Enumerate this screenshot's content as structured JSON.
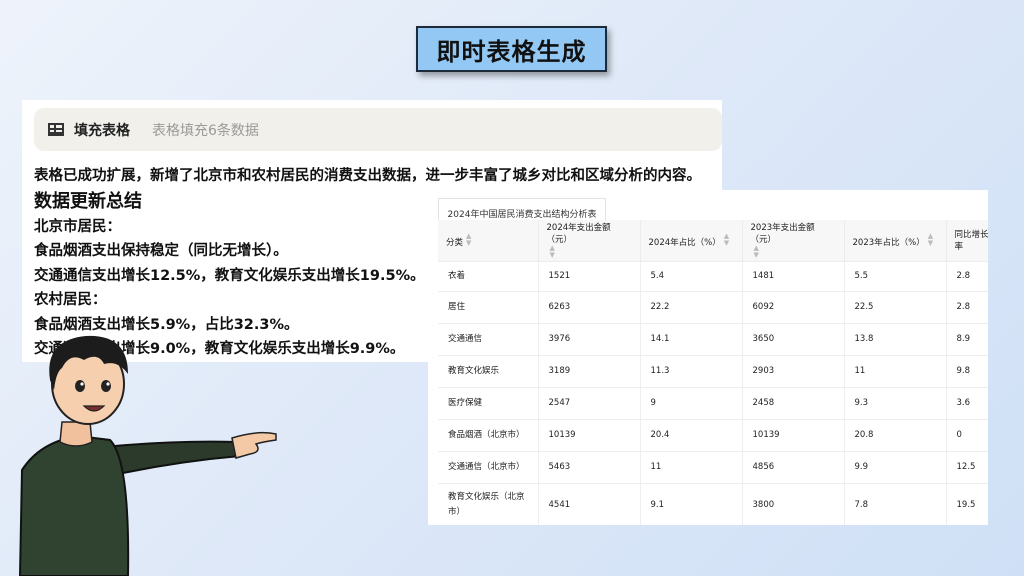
{
  "header": {
    "title": "即时表格生成"
  },
  "tool_call": {
    "icon": "table-icon",
    "name": "填充表格",
    "description": "表格填充6条数据"
  },
  "message": {
    "intro": "表格已成功扩展，新增了北京市和农村居民的消费支出数据，进一步丰富了城乡对比和区域分析的内容。",
    "summary_heading": "数据更新总结",
    "sections": [
      {
        "heading": "北京市居民：",
        "lines": [
          "食品烟酒支出保持稳定（同比无增长）。",
          "交通通信支出增长12.5%，教育文化娱乐支出增长19.5%。"
        ]
      },
      {
        "heading": "农村居民：",
        "lines": [
          "食品烟酒支出增长5.9%，占比32.3%。",
          "交通通信支出增长9.0%，教育文化娱乐支出增长9.9%。"
        ]
      }
    ]
  },
  "table": {
    "tab_label": "2024年中国居民消费支出结构分析表",
    "columns": [
      "分类",
      "2024年支出金额（元）",
      "2024年占比（%）",
      "2023年支出金额（元）",
      "2023年占比（%）",
      "同比增长率"
    ],
    "rows": [
      [
        "衣着",
        "1521",
        "5.4",
        "1481",
        "5.5",
        "2.8"
      ],
      [
        "居住",
        "6263",
        "22.2",
        "6092",
        "22.5",
        "2.8"
      ],
      [
        "交通通信",
        "3976",
        "14.1",
        "3650",
        "13.8",
        "8.9"
      ],
      [
        "教育文化娱乐",
        "3189",
        "11.3",
        "2903",
        "11",
        "9.8"
      ],
      [
        "医疗保健",
        "2547",
        "9",
        "2458",
        "9.3",
        "3.6"
      ],
      [
        "食品烟酒（北京市）",
        "10139",
        "20.4",
        "10139",
        "20.8",
        "0"
      ],
      [
        "交通通信（北京市）",
        "5463",
        "11",
        "4856",
        "9.9",
        "12.5"
      ],
      [
        "教育文化娱乐（北京市）",
        "4541",
        "9.1",
        "3800",
        "7.8",
        "19.5"
      ]
    ]
  }
}
